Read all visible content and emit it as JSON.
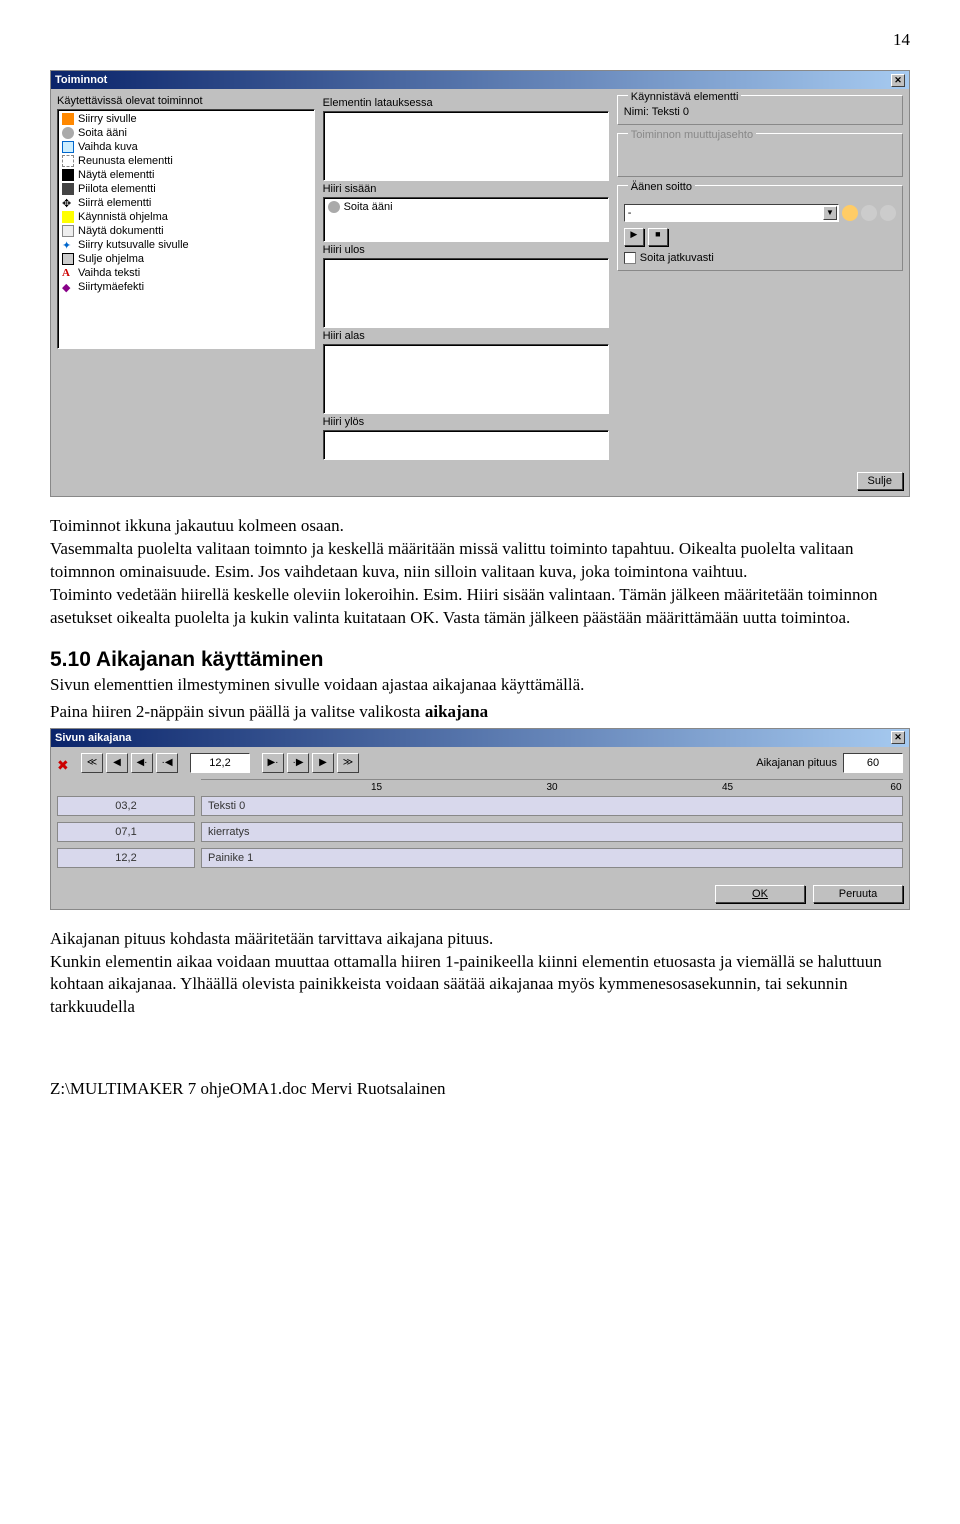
{
  "page_number": "14",
  "dialog1": {
    "title": "Toiminnot",
    "col_available": "Käytettävissä olevat toiminnot",
    "actions": [
      "Siirry sivulle",
      "Soita ääni",
      "Vaihda kuva",
      "Reunusta elementti",
      "Näytä elementti",
      "Piilota elementti",
      "Siirrä elementti",
      "Käynnistä ohjelma",
      "Näytä dokumentti",
      "Siirry kutsuvalle sivulle",
      "Sulje ohjelma",
      "Vaihda teksti",
      "Siirtymäefekti"
    ],
    "col_load": "Elementin latauksessa",
    "hiiri_sisaan": "Hiiri sisään",
    "hiiri_sisaan_item": "Soita ääni",
    "hiiri_ulos": "Hiiri ulos",
    "hiiri_alas": "Hiiri alas",
    "hiiri_ylos": "Hiiri ylös",
    "kaynnistava": "Käynnistävä elementti",
    "nimi_label": "Nimi: Teksti 0",
    "muutto": "Toiminnon muuttujasehto",
    "aanen": "Äänen soitto",
    "dd_value": "-",
    "soita_jatk": "Soita jatkuvasti",
    "close_btn": "Sulje"
  },
  "body1": "Toiminnot ikkuna jakautuu kolmeen osaan.\nVasemmalta puolelta valitaan toimnto ja keskellä määritään missä valittu toiminto tapahtuu. Oikealta puolelta valitaan toimnnon ominaisuude. Esim. Jos vaihdetaan kuva, niin silloin valitaan kuva, joka toimintona vaihtuu.\nToiminto vedetään hiirellä keskelle oleviin lokeroihin. Esim. Hiiri sisään valintaan. Tämän jälkeen määritetään toiminnon asetukset  oikealta puolelta ja kukin valinta kuitataan OK. Vasta tämän jälkeen päästään määrittämään uutta toimintoa.",
  "section_title": "5.10 Aikajanan käyttäminen",
  "section_intro1": "Sivun elementtien ilmestyminen sivulle voidaan ajastaa aikajanaa käyttämällä.",
  "section_intro2a": "Paina hiiren 2-näppäin sivun päällä ja valitse valikosta ",
  "section_intro2b": "aikajana",
  "dialog2": {
    "title": "Sivun aikajana",
    "time_value": "12,2",
    "len_label": "Aikajanan pituus",
    "len_value": "60",
    "ticks": [
      "15",
      "30",
      "45",
      "60"
    ],
    "rows": [
      {
        "time": "03,2",
        "label": "Teksti 0"
      },
      {
        "time": "07,1",
        "label": "kierratys"
      },
      {
        "time": "12,2",
        "label": "Painike 1"
      }
    ],
    "ok": "OK",
    "cancel": "Peruuta"
  },
  "body2": "Aikajanan pituus kohdasta määritetään tarvittava aikajana pituus.\nKunkin elementin aikaa voidaan muuttaa ottamalla hiiren 1-painikeella kiinni elementin etuosasta ja viemällä se haluttuun kohtaan aikajanaa. Ylhäällä olevista painikkeista voidaan säätää aikajanaa myös kymmenesosasekunnin, tai sekunnin tarkkuudella",
  "footer_path": "Z:\\MULTIMAKER 7 ohjeOMA1.doc Mervi Ruotsalainen"
}
